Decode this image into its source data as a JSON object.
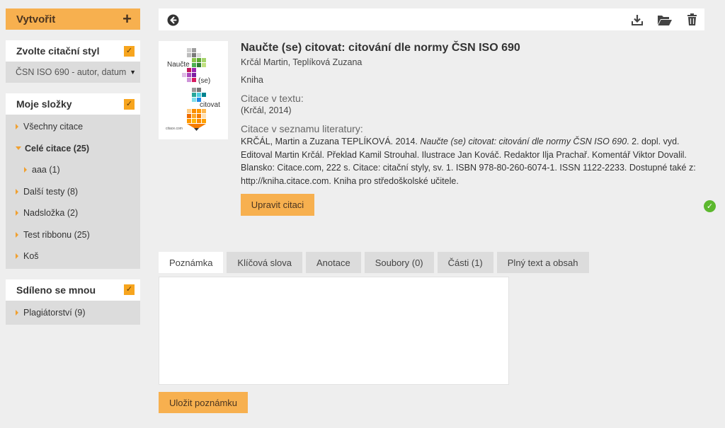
{
  "sidebar": {
    "create_label": "Vytvořit",
    "create_icon": "plus-icon",
    "style_panel": {
      "title": "Zvolte citační styl",
      "selected": "ČSN ISO 690 - autor, datum"
    },
    "folders_panel": {
      "title": "Moje složky",
      "items": [
        {
          "label": "Všechny citace"
        },
        {
          "label": "Celé citace (25)"
        },
        {
          "label": "aaa (1)"
        },
        {
          "label": "Další testy (8)"
        },
        {
          "label": "Nadsložka (2)"
        },
        {
          "label": "Test ribbonu (25)"
        },
        {
          "label": "Koš"
        }
      ]
    },
    "shared_panel": {
      "title": "Sdíleno se mnou",
      "items": [
        {
          "label": "Plagiátorství (9)"
        }
      ]
    }
  },
  "toolbar": {
    "back_icon": "back-arrow-icon",
    "download_icon": "download-icon",
    "folder_icon": "folder-open-icon",
    "delete_icon": "trash-icon"
  },
  "book": {
    "cover_words": [
      "Naučte",
      "(se)",
      "citovat"
    ],
    "cover_brand": "citace.com",
    "title": "Naučte (se) citovat: citování dle normy ČSN ISO 690",
    "authors": "Krčál Martin, Teplíková Zuzana",
    "type": "Kniha",
    "intext_label": "Citace v textu:",
    "intext": "(Krčál, 2014)",
    "biblio_label": "Citace v seznamu literatury:",
    "biblio_pre": "KRČÁL, Martin a Zuzana TEPLÍKOVÁ. 2014. ",
    "biblio_italic": "Naučte (se) citovat: citování dle normy ČSN ISO 690",
    "biblio_post": ". 2. dopl. vyd. Editoval Martin Krčál. Překlad Kamil Strouhal. Ilustrace Jan Kováč. Redaktor Ilja Prachař. Komentář Viktor Dovalil. Blansko: Citace.com, 222 s. Citace: citační styly, sv. 1. ISBN 978-80-260-6074-1. ISSN 1122-2233. Dostupné také z: http://kniha.citace.com. Kniha pro středoškolské učitele.",
    "edit_label": "Upravit citaci",
    "status_color": "#5cb82e"
  },
  "tabs": [
    {
      "label": "Poznámka"
    },
    {
      "label": "Klíčová slova"
    },
    {
      "label": "Anotace"
    },
    {
      "label": "Soubory (0)"
    },
    {
      "label": "Části (1)"
    },
    {
      "label": "Plný text a obsah"
    }
  ],
  "note": {
    "value": "",
    "save_label": "Uložit poznámku"
  },
  "colors": {
    "accent": "#f7b04f",
    "checkbox": "#f7a51e",
    "panel_bg": "#dcdcdc"
  }
}
